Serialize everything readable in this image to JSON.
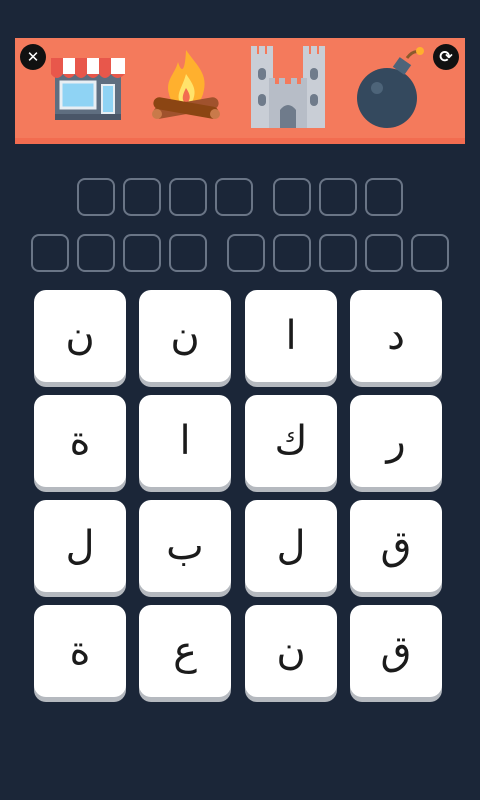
{
  "banner": {
    "close_icon": "close-icon",
    "refresh_icon": "refresh-icon",
    "pictures": [
      "shop-icon",
      "campfire-icon",
      "castle-icon",
      "bomb-icon"
    ],
    "colors": {
      "background": "#f47a5c",
      "bottom_border": "#f26c50"
    }
  },
  "answer": {
    "rows": [
      {
        "words": [
          4,
          3
        ]
      },
      {
        "words": [
          4,
          5
        ]
      }
    ]
  },
  "letters": {
    "rows": [
      [
        "د",
        "ا",
        "ن",
        "ن"
      ],
      [
        "ر",
        "ك",
        "ا",
        "ة"
      ],
      [
        "ق",
        "ل",
        "ب",
        "ل"
      ],
      [
        "ق",
        "ن",
        "ع",
        "ة"
      ]
    ]
  },
  "colors": {
    "page_background": "#1b2638",
    "slot_border": "#6a7586",
    "tile_background": "#ffffff",
    "tile_shadow": "#b5b9bf"
  }
}
